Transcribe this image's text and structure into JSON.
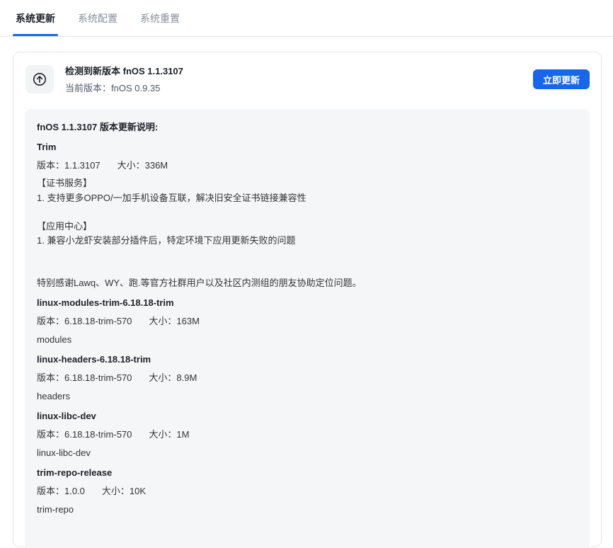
{
  "tabs": [
    {
      "label": "系统更新",
      "active": true
    },
    {
      "label": "系统配置",
      "active": false
    },
    {
      "label": "系统重置",
      "active": false
    }
  ],
  "update": {
    "icon": "arrow-up-circle-icon",
    "title": "检测到新版本 fnOS 1.1.3107",
    "current": "当前版本：fnOS 0.9.35",
    "button_label": "立即更新",
    "accent_color": "#1767e8"
  },
  "notes": {
    "heading": "fnOS 1.1.3107 版本更新说明:",
    "packages": [
      {
        "name": "Trim",
        "version": "版本：1.1.3107",
        "size": "大小：336M"
      },
      {
        "name": "linux-modules-trim-6.18.18-trim",
        "version": "版本：6.18.18-trim-570",
        "size": "大小：163M",
        "desc": "modules"
      },
      {
        "name": "linux-headers-6.18.18-trim",
        "version": "版本：6.18.18-trim-570",
        "size": "大小：8.9M",
        "desc": "headers"
      },
      {
        "name": "linux-libc-dev",
        "version": "版本：6.18.18-trim-570",
        "size": "大小：1M",
        "desc": "linux-libc-dev"
      },
      {
        "name": "trim-repo-release",
        "version": "版本：1.0.0",
        "size": "大小：10K",
        "desc": "trim-repo"
      }
    ],
    "trim_notes": [
      "【证书服务】",
      "1. 支持更多OPPO/一加手机设备互联，解决旧安全证书链接兼容性",
      "【应用中心】",
      "1. 兼容小龙虾安装部分插件后，特定环境下应用更新失败的问题",
      "特别感谢Lawq、WY、跑.等官方社群用户以及社区内测组的朋友协助定位问题。"
    ]
  }
}
